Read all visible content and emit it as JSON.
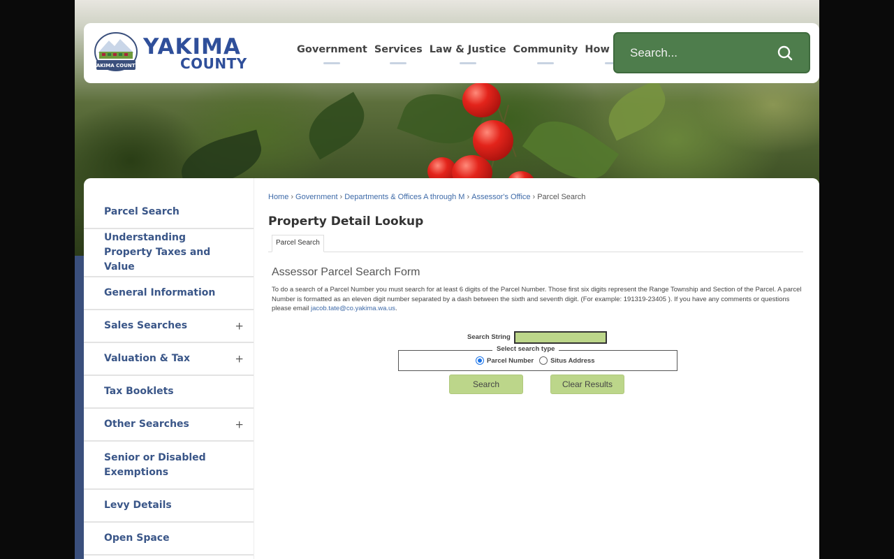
{
  "logo": {
    "line1": "YAKIMA",
    "line2": "COUNTY",
    "badge": "YAKIMA COUNTY"
  },
  "nav": [
    "Government",
    "Services",
    "Law & Justice",
    "Community",
    "How Do I?"
  ],
  "search": {
    "placeholder": "Search..."
  },
  "sidebar": {
    "items": [
      {
        "label": "Parcel Search",
        "expandable": false
      },
      {
        "label": "Understanding Property Taxes and Value",
        "expandable": false
      },
      {
        "label": "General Information",
        "expandable": false
      },
      {
        "label": "Sales Searches",
        "expandable": true
      },
      {
        "label": "Valuation & Tax",
        "expandable": true
      },
      {
        "label": "Tax Booklets",
        "expandable": false
      },
      {
        "label": "Other Searches",
        "expandable": true
      },
      {
        "label": "Senior or Disabled Exemptions",
        "expandable": false
      },
      {
        "label": "Levy Details",
        "expandable": false
      },
      {
        "label": "Open Space",
        "expandable": false
      }
    ],
    "expand_symbol": "+"
  },
  "breadcrumb": {
    "items": [
      "Home",
      "Government",
      "Departments & Offices A through M",
      "Assessor's Office"
    ],
    "current": "Parcel Search",
    "separator": "›"
  },
  "page_title": "Property Detail Lookup",
  "tab_label": "Parcel Search",
  "form": {
    "title": "Assessor Parcel Search Form",
    "description": "To do a search of a Parcel Number you must search for at least 6 digits of the Parcel Number. Those first six digits represent the Range Township and Section of the Parcel. A parcel Number is formatted as an eleven digit number separated by a dash between the sixth and seventh digit. (For example: 191319-23405 ). If you have any comments or questions please email",
    "email": "jacob.tate@co.yakima.wa.us",
    "email_suffix": ".",
    "search_string_label": "Search String",
    "search_string_value": "",
    "legend": "Select search type",
    "radio_parcel": "Parcel Number",
    "radio_situs": "Situs Address",
    "selected": "Parcel Number",
    "search_button": "Search",
    "clear_button": "Clear Results"
  },
  "colors": {
    "brand_blue": "#2f4f9a",
    "search_green": "#4e7d4c",
    "button_green": "#bcd68a",
    "link_blue": "#3e6aa8"
  }
}
